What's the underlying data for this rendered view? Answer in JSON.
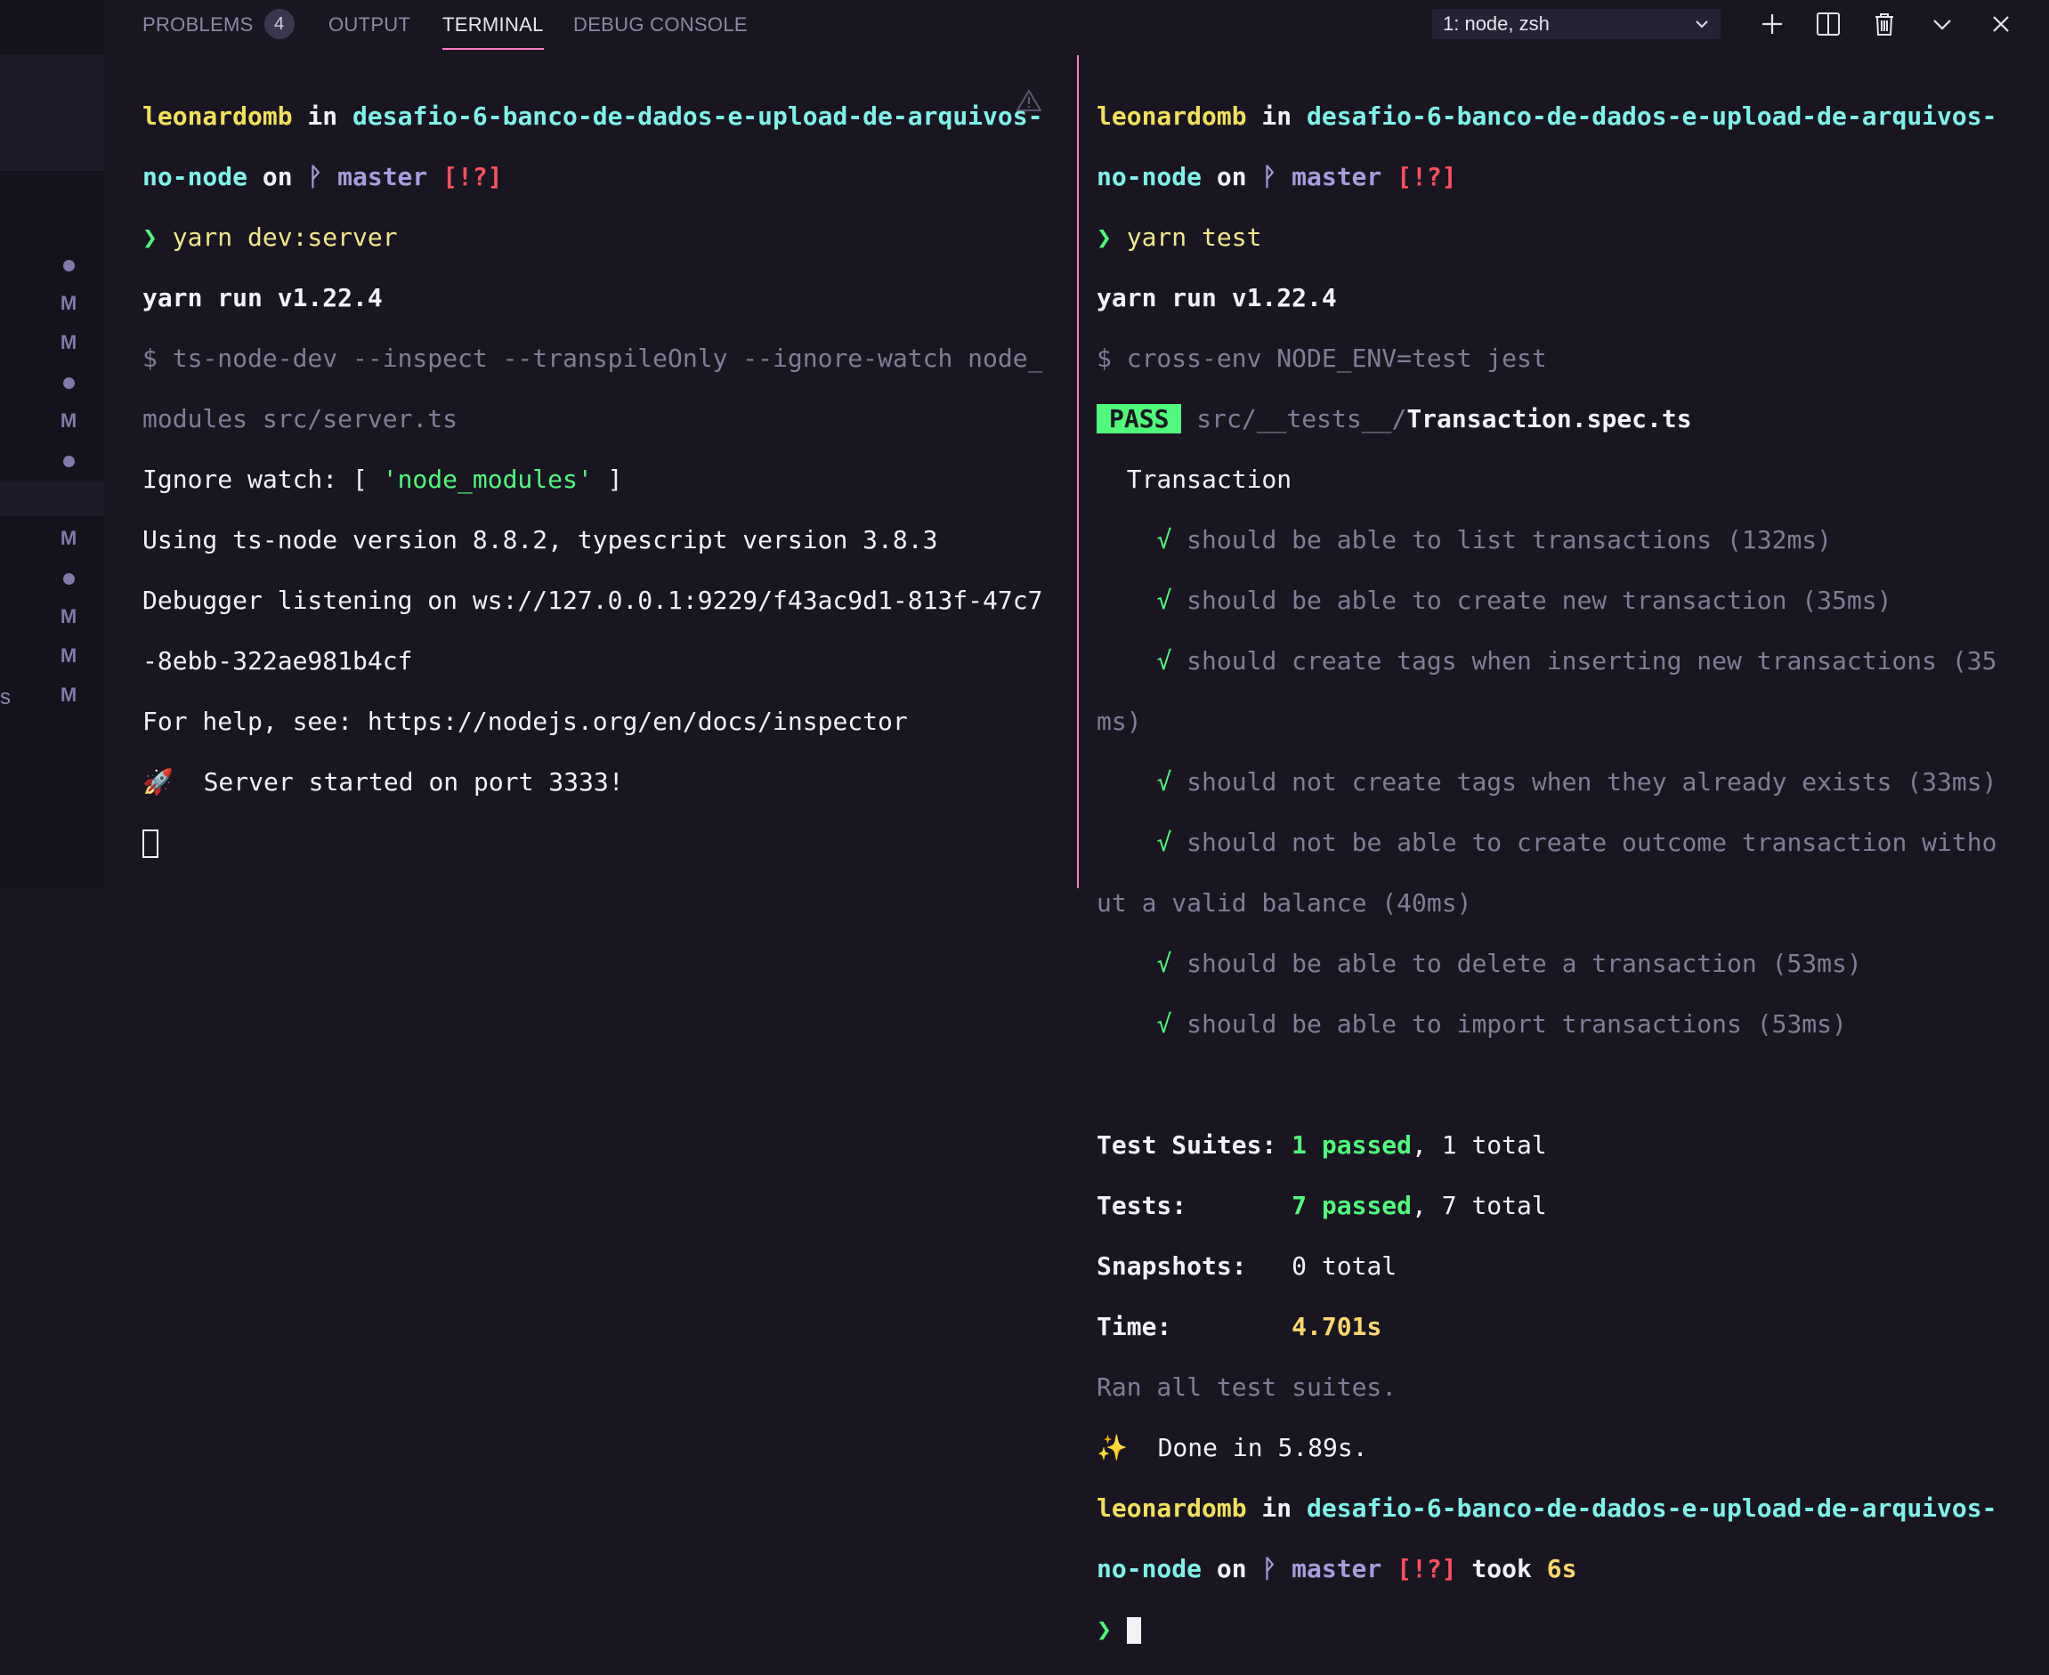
{
  "tabs": {
    "problems": "PROBLEMS",
    "problems_count": "4",
    "output": "OUTPUT",
    "terminal": "TERMINAL",
    "debug": "DEBUG CONSOLE"
  },
  "terminal_select": "1: node, zsh",
  "sidebar_markers": [
    "●",
    "M",
    "M",
    "●",
    "M",
    "●",
    "M",
    "●",
    "M",
    "M",
    "M"
  ],
  "sidebar_edge_text": "s",
  "left": {
    "user": "leonardomb",
    "in": " in ",
    "dir1": "desafio-6-banco-de-dados-e-upload-de-arquivos-",
    "dir2": "no-node",
    "on": " on ",
    "branch_icon": "",
    "branch": " master ",
    "status": "[!?]",
    "prompt": "❯ ",
    "cmd": "yarn dev:server",
    "yarn_run": "yarn run v1.22.4",
    "cmd_echo1": "$ ts-node-dev --inspect --transpileOnly --ignore-watch node_",
    "cmd_echo2": "modules src/server.ts",
    "ignore_a": "Ignore watch: [ ",
    "ignore_b": "'node_modules'",
    "ignore_c": " ]",
    "tsnode": "Using ts-node version 8.8.2, typescript version 3.8.3",
    "debugger1": "Debugger listening on ws://127.0.0.1:9229/f43ac9d1-813f-47c7",
    "debugger2": "-8ebb-322ae981b4cf",
    "help": "For help, see: https://nodejs.org/en/docs/inspector",
    "started": "🚀  Server started on port 3333!"
  },
  "right": {
    "cmd": "yarn test",
    "yarn_run": "yarn run v1.22.4",
    "cmd_echo": "$ cross-env NODE_ENV=test jest",
    "pass": "PASS",
    "spec_dir": " src/__tests__/",
    "spec_file": "Transaction.spec.ts",
    "suite": "  Transaction",
    "tests": [
      "    √ should be able to list transactions (132ms)",
      "    √ should be able to create new transaction (35ms)",
      "    √ should create tags when inserting new transactions (35",
      "ms)",
      "    √ should not create tags when they already exists (33ms)",
      "    √ should not be able to create outcome transaction witho",
      "ut a valid balance (40ms)",
      "    √ should be able to delete a transaction (53ms)",
      "    √ should be able to import transactions (53ms)"
    ],
    "suites_label": "Test Suites: ",
    "suites_passed": "1 passed",
    "suites_total": ", 1 total",
    "tests_label": "Tests:       ",
    "tests_passed": "7 passed",
    "tests_total": ", 7 total",
    "snap_label": "Snapshots:   ",
    "snap_value": "0 total",
    "time_label": "Time:        ",
    "time_value": "4.701s",
    "ran": "Ran all test suites.",
    "done": "✨  Done in 5.89s.",
    "took": " took ",
    "took_value": "6s"
  },
  "colors": {
    "accent": "#ff79c6",
    "user": "#f1e05a",
    "directory": "#7ff2e9",
    "branch": "#a89cdb",
    "status": "#ff4f5e",
    "success": "#50fa7b",
    "background": "#191622"
  },
  "icons": [
    "warning-icon",
    "add-icon",
    "split-icon",
    "trash-icon",
    "chevron-down-icon",
    "close-icon",
    "branch-icon"
  ]
}
